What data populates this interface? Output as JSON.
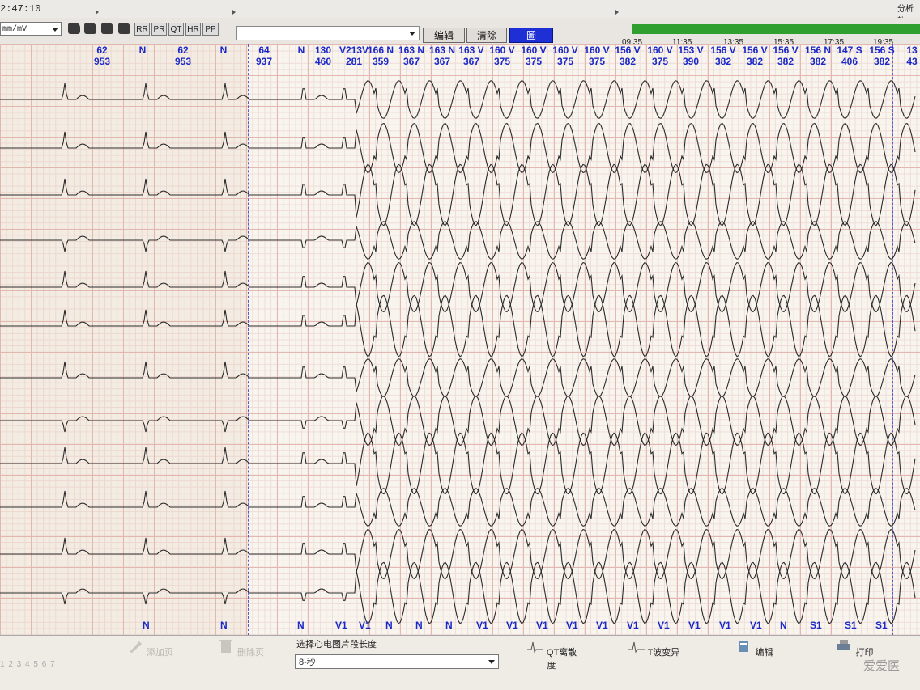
{
  "window": {
    "clock": "2:47:10",
    "analysis_label": "分析轨"
  },
  "toolbar": {
    "unit_select": "mm/mV",
    "buttons": [
      "RR",
      "PR",
      "QT",
      "HR",
      "PP"
    ],
    "edit_label": "编辑",
    "clear_label": "清除",
    "graph_label": "圖"
  },
  "timeline": {
    "labels": [
      "09:35",
      "11:35",
      "13:35",
      "15:35",
      "17:35",
      "19:35"
    ]
  },
  "top_annotations": [
    {
      "hr": "62",
      "rr": "953"
    },
    {
      "hr": "N",
      "rr": ""
    },
    {
      "hr": "62",
      "rr": "953"
    },
    {
      "hr": "N",
      "rr": ""
    },
    {
      "hr": "64",
      "rr": "937"
    },
    {
      "hr": "N",
      "rr": ""
    },
    {
      "hr": "130",
      "rr": "460"
    },
    {
      "hr": "V213V",
      "rr": "281"
    },
    {
      "hr": "166 N",
      "rr": "359"
    },
    {
      "hr": "163 N",
      "rr": "367"
    },
    {
      "hr": "163 N",
      "rr": "367"
    },
    {
      "hr": "163 V",
      "rr": "367"
    },
    {
      "hr": "160 V",
      "rr": "375"
    },
    {
      "hr": "160 V",
      "rr": "375"
    },
    {
      "hr": "160 V",
      "rr": "375"
    },
    {
      "hr": "160 V",
      "rr": "375"
    },
    {
      "hr": "156 V",
      "rr": "382"
    },
    {
      "hr": "160 V",
      "rr": "375"
    },
    {
      "hr": "153 V",
      "rr": "390"
    },
    {
      "hr": "156 V",
      "rr": "382"
    },
    {
      "hr": "156 V",
      "rr": "382"
    },
    {
      "hr": "156 V",
      "rr": "382"
    },
    {
      "hr": "156 N",
      "rr": "382"
    },
    {
      "hr": "147 S",
      "rr": "406"
    },
    {
      "hr": "156 S",
      "rr": "382"
    },
    {
      "hr": "13",
      "rr": "43"
    }
  ],
  "beat_labels": [
    "N",
    "N",
    "N",
    "V1",
    "V1",
    "N",
    "N",
    "N",
    "V1",
    "V1",
    "V1",
    "V1",
    "V1",
    "V1",
    "V1",
    "V1",
    "V1",
    "V1",
    "N",
    "S1",
    "S1",
    "S1"
  ],
  "bottom": {
    "pages": "1 2 3 4 5 6 7",
    "add_label": "添加页",
    "delete_label": "删除页",
    "segment_label": "选择心电图片段长度",
    "segment_value": "8-秒",
    "qt_label": "QT离散度",
    "twave_label": "T波变异",
    "edit_label": "编辑",
    "print_label": "打印"
  },
  "watermark": "爱爱医"
}
